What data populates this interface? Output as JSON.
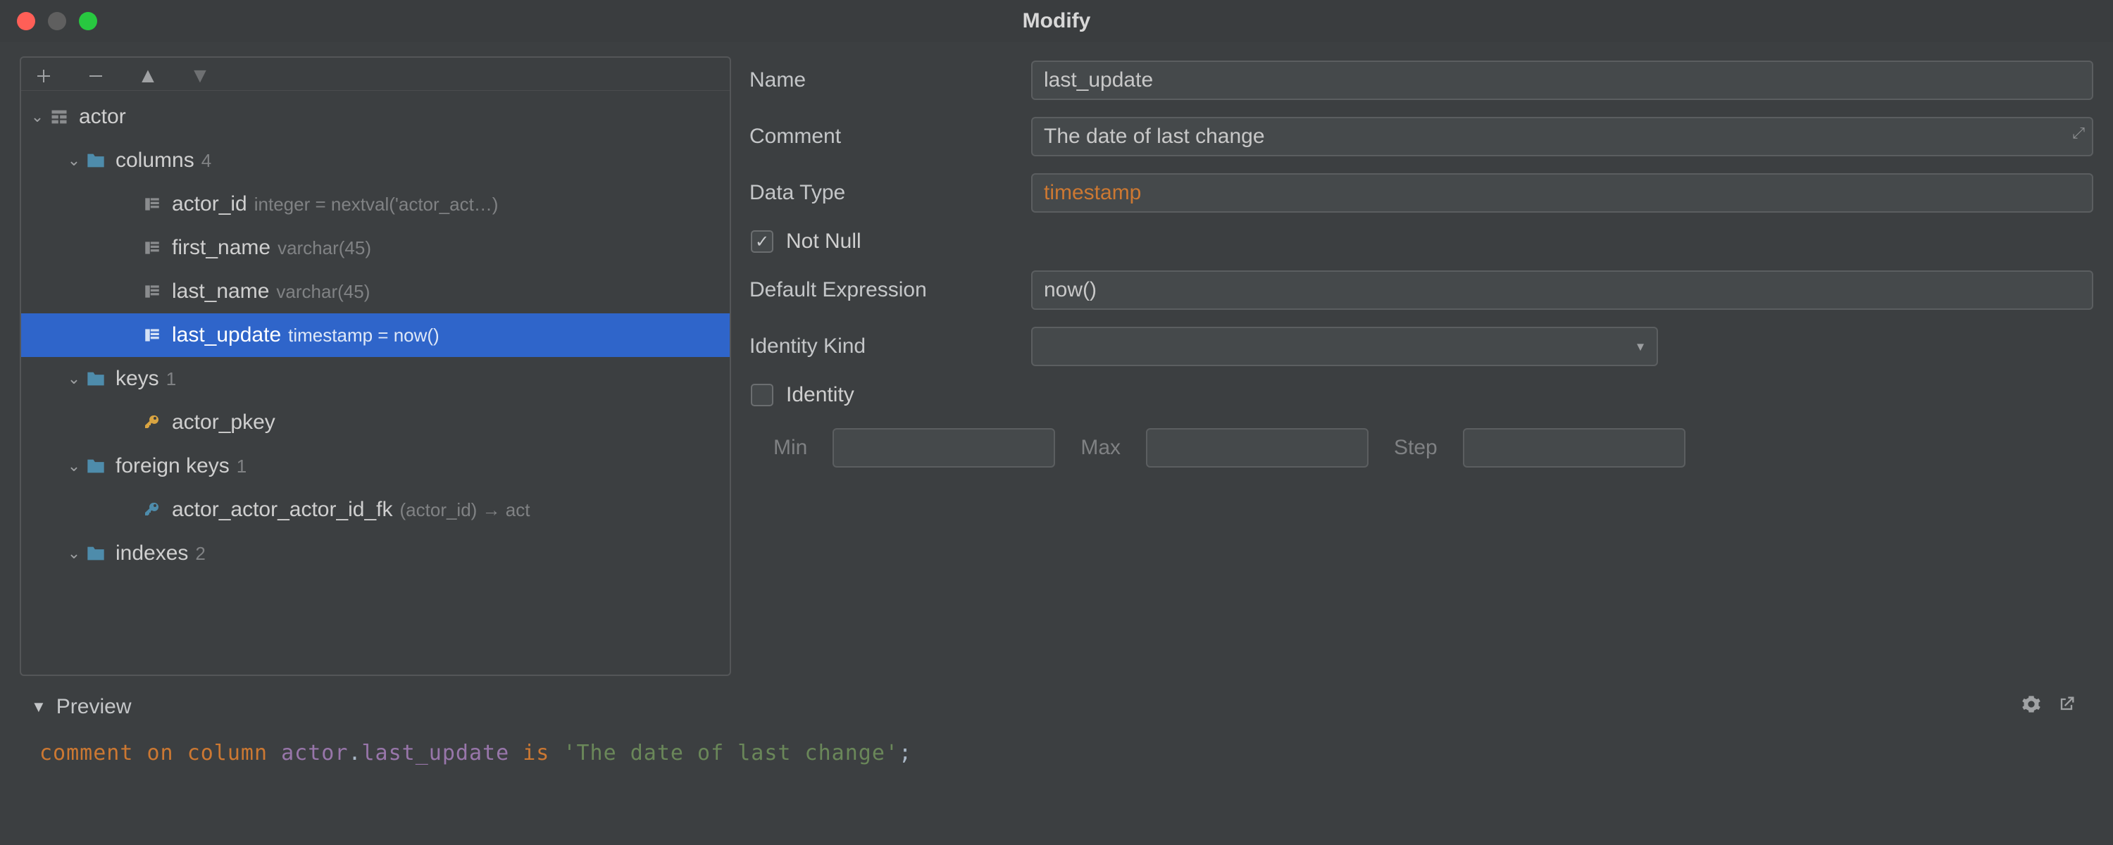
{
  "window": {
    "title": "Modify"
  },
  "tree": {
    "table": {
      "name": "actor"
    },
    "columns": {
      "label": "columns",
      "count": "4",
      "items": [
        {
          "name": "actor_id",
          "detail": "integer = nextval('actor_act…)"
        },
        {
          "name": "first_name",
          "detail": "varchar(45)"
        },
        {
          "name": "last_name",
          "detail": "varchar(45)"
        },
        {
          "name": "last_update",
          "detail": "timestamp = now()"
        }
      ]
    },
    "keys": {
      "label": "keys",
      "count": "1",
      "items": [
        {
          "name": "actor_pkey"
        }
      ]
    },
    "foreignKeys": {
      "label": "foreign keys",
      "count": "1",
      "items": [
        {
          "name": "actor_actor_actor_id_fk",
          "detail": "(actor_id) → act"
        }
      ]
    },
    "indexes": {
      "label": "indexes",
      "count": "2"
    }
  },
  "form": {
    "name": {
      "label": "Name",
      "value": "last_update"
    },
    "comment": {
      "label": "Comment",
      "value": "The date of last change"
    },
    "dataType": {
      "label": "Data Type",
      "value": "timestamp"
    },
    "notNull": {
      "label": "Not Null",
      "checked": true
    },
    "defaultExpr": {
      "label": "Default Expression",
      "value": "now()"
    },
    "identityKind": {
      "label": "Identity Kind",
      "value": ""
    },
    "identity": {
      "label": "Identity",
      "checked": false
    },
    "min": {
      "label": "Min",
      "value": ""
    },
    "max": {
      "label": "Max",
      "value": ""
    },
    "step": {
      "label": "Step",
      "value": ""
    }
  },
  "preview": {
    "label": "Preview",
    "sql": {
      "kw_comment": "comment",
      "kw_on": "on",
      "kw_column": "column",
      "tbl": "actor",
      "dot": ".",
      "col": "last_update",
      "kw_is": "is",
      "str": "'The date of last change'",
      "semi": ";"
    }
  }
}
